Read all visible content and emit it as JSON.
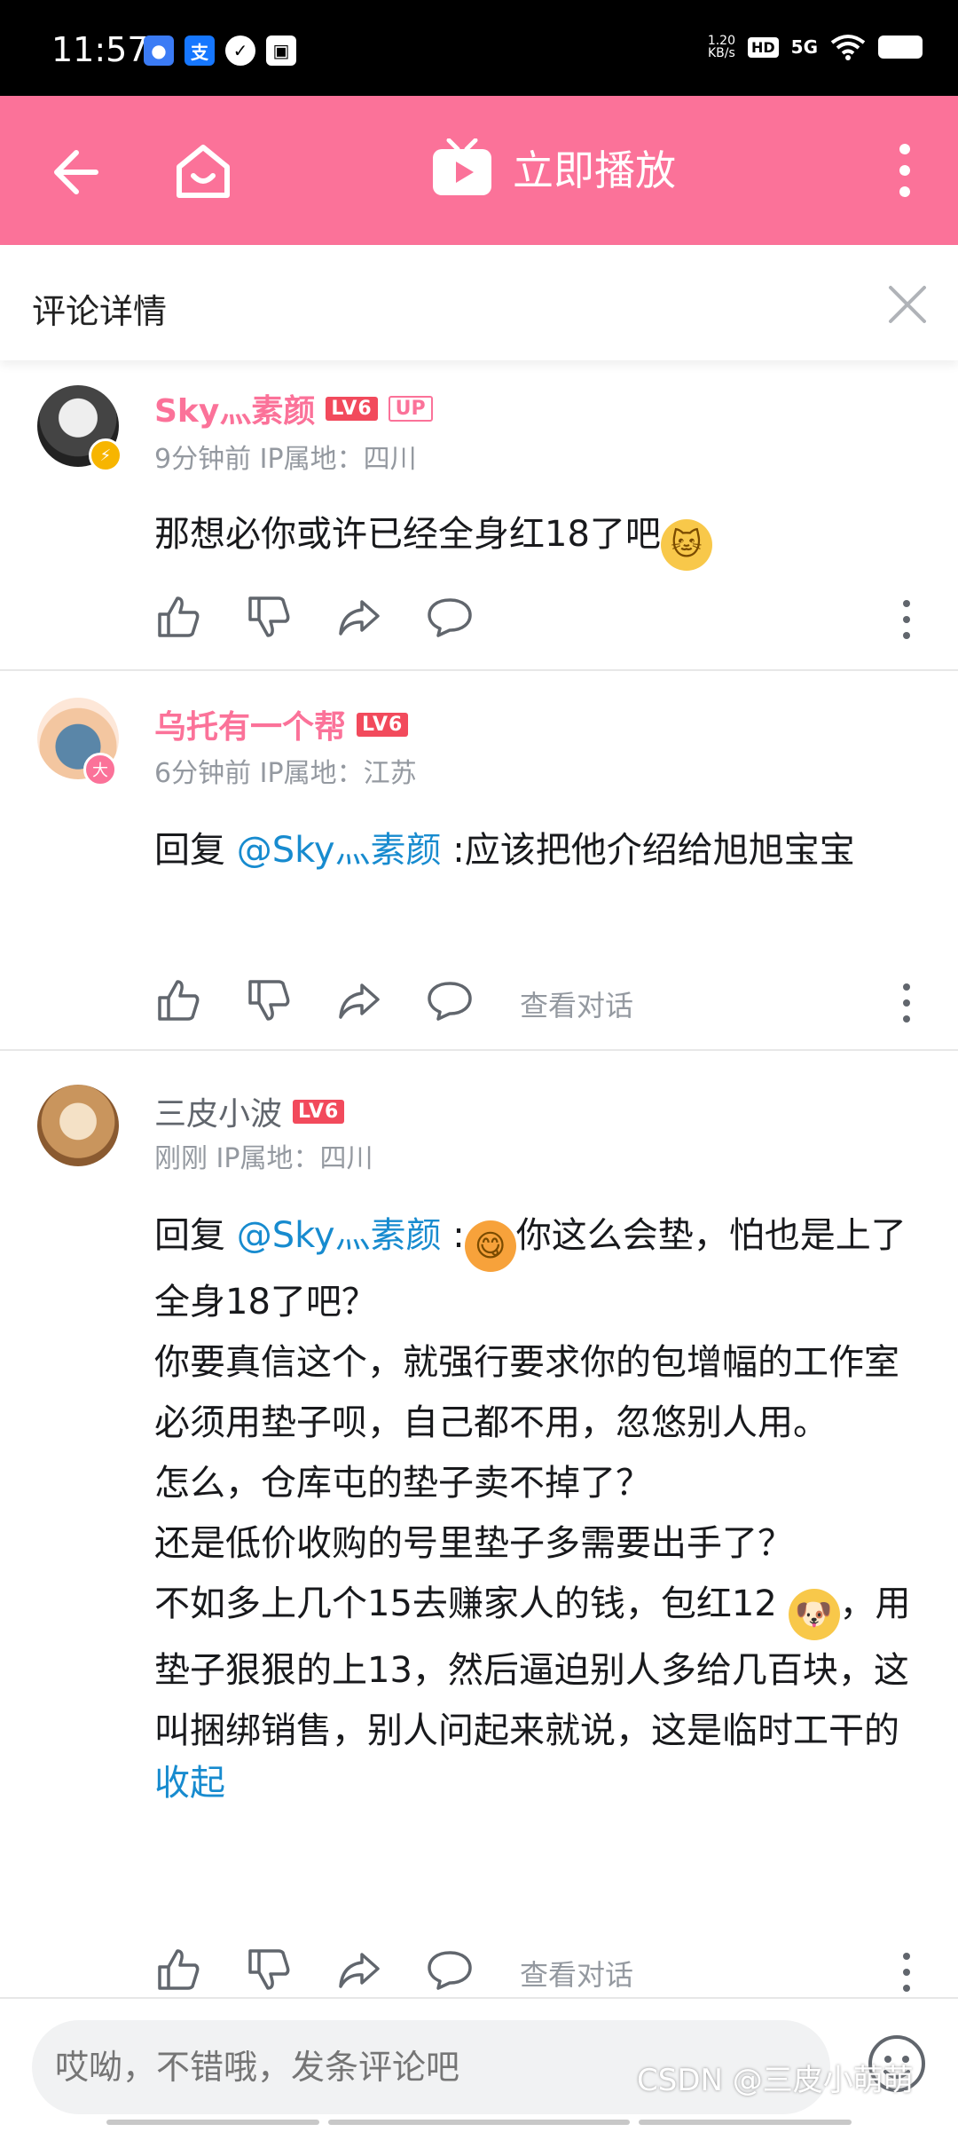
{
  "status_bar": {
    "time": "11:57",
    "net_speed_value": "1.20",
    "net_speed_unit": "KB/s",
    "hd": "HD",
    "signal": "5G"
  },
  "top_bar": {
    "play_label": "立即播放",
    "accent_color": "#fb7299"
  },
  "panel": {
    "title": "评论详情"
  },
  "comments": [
    {
      "username": "Sky灬素颜",
      "level": "LV6",
      "badge": "UP",
      "time": "9分钟前",
      "ip": "IP属地：四川",
      "text": "那想必你或许已经全身红18了吧",
      "emoji": "slightly-smiling-dog-emoji"
    },
    {
      "username": "乌托有一个帮",
      "level": "LV6",
      "time": "6分钟前",
      "ip": "IP属地：江苏",
      "reply_prefix": "回复",
      "mention": "@Sky灬素颜",
      "text": ":应该把他介绍给旭旭宝宝",
      "view_dialog": "查看对话"
    },
    {
      "username": "三皮小波",
      "level": "LV6",
      "time": "刚刚",
      "ip": "IP属地：四川",
      "reply_prefix": "回复",
      "mention": "@Sky灬素颜",
      "colon": ":",
      "text_1": "你这么会垫，怕也是上了全身18了吧？",
      "text_2": "你要真信这个，就强行要求你的包增幅的工作室必须用垫子呗，自己都不用，忽悠别人用。",
      "text_3": "怎么，仓库屯的垫子卖不掉了？",
      "text_4": "还是低价收购的号里垫子多需要出手了？",
      "text_5a": "不如多上几个15去赚家人的钱，包红12",
      "text_5b": "，用垫子狠狠的上13，然后逼迫别人多给几百块，这叫捆绑销售，别人问起来就说，这是临时工干的",
      "collapse": "收起",
      "view_dialog": "查看对话"
    }
  ],
  "bottom": {
    "input_placeholder": "哎呦，不错哦，发条评论吧",
    "watermark": "CSDN @三皮小萌萌"
  }
}
